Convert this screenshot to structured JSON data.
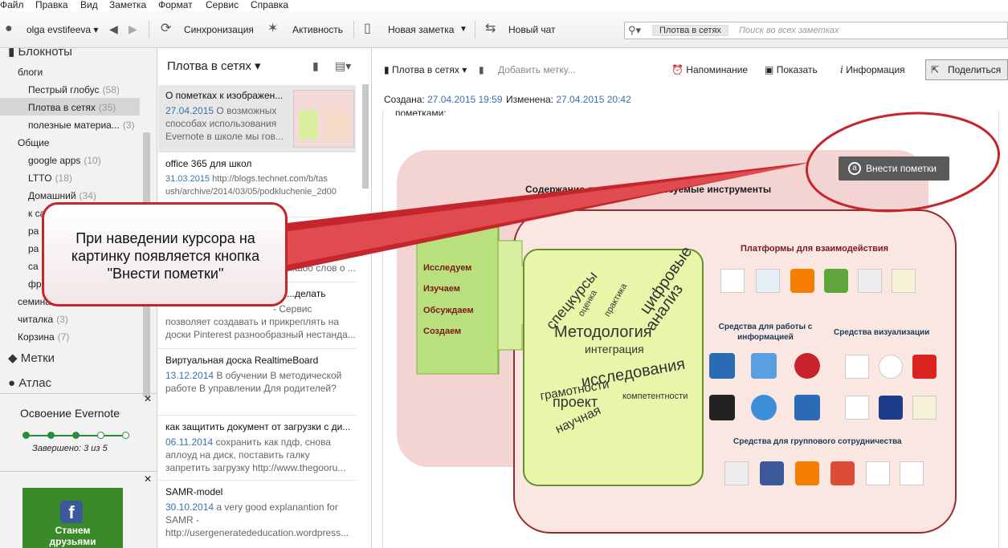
{
  "menu": [
    "Файл",
    "Правка",
    "Вид",
    "Заметка",
    "Формат",
    "Сервис",
    "Справка"
  ],
  "toolbar": {
    "user": "olga evstifeeva",
    "sync": "Синхронизация",
    "activity": "Активность",
    "new_note": "Новая заметка",
    "new_chat": "Новый чат",
    "search_scope": "Плотва в сетях",
    "search_placeholder": "Поиск во всех заметках"
  },
  "sidebar": {
    "notebooks_header": "Блокноты",
    "stacks": [
      {
        "label": "блоги",
        "items": [
          {
            "label": "Пестрый глобус",
            "count": "(58)"
          },
          {
            "label": "Плотва в сетях",
            "count": "(35)"
          },
          {
            "label": "полезные материа...",
            "count": "(3)"
          }
        ]
      },
      {
        "label": "Общие",
        "items": [
          {
            "label": "google apps",
            "count": "(10)"
          },
          {
            "label": "LTTO",
            "count": "(18)"
          },
          {
            "label": "Домашний",
            "count": "(34)"
          },
          {
            "label": "к са",
            "count": ""
          },
          {
            "label": "ра",
            "count": ""
          },
          {
            "label": "ра",
            "count": ""
          },
          {
            "label": "са",
            "count": ""
          },
          {
            "label": "фр",
            "count": ""
          }
        ]
      }
    ],
    "semina": "семина",
    "reader": {
      "label": "читалка",
      "count": "(3)"
    },
    "trash": {
      "label": "Корзина",
      "count": "(7)"
    },
    "tags": "Метки",
    "atlas": "Атлас",
    "learn_title": "Освоение Evernote",
    "learn_progress_text": "Завершено: 3 из 5",
    "learn_progress": {
      "done": 3,
      "total": 5
    },
    "fb_line1": "Станем",
    "fb_line2": "друзьями"
  },
  "note_list": {
    "title": "Плотва в сетях",
    "notes": [
      {
        "title": "О пометках к изображен...",
        "date": "27.04.2015",
        "snippet": [
          "О возможных",
          "способах использования",
          "Evernote в школе мы гов..."
        ]
      },
      {
        "title": "office 365 для школ",
        "date": "31.03.2015",
        "snippet": [
          "http://blogs.technet.com/b/tas",
          "ush/archive/2014/03/05/podkluchenie_2d00"
        ]
      },
      {
        "title": "",
        "date": "",
        "snippet": [
          "",
          "",
          "...шоо слов о ..."
        ]
      },
      {
        "title": "...делать",
        "date": "",
        "snippet": [
          "- Сервис",
          "позволяет создавать и прикреплять на",
          "доски Pinterest разнообразный нестанда..."
        ]
      },
      {
        "title": "Виртуальная доска RealtimeBoard",
        "date": "13.12.2014",
        "snippet": [
          "В обучении В методической",
          "работе В управлении Для родителей?"
        ]
      },
      {
        "title": "как защитить документ от загрузки с ди...",
        "date": "06.11.2014",
        "snippet": [
          "сохранить как пдф, снова",
          "аплоуд на диск, поставить галку",
          "запретить загрузку http://www.thegooru..."
        ]
      },
      {
        "title": "SAMR-model",
        "date": "30.10.2014",
        "snippet": [
          "a very good explanantion for",
          "SAMR -",
          "http://usergeneratededucation.wordpress..."
        ]
      }
    ]
  },
  "note": {
    "notebook": "Плотва в сетях",
    "add_tag": "Добавить метку...",
    "reminder": "Напоминание",
    "present": "Показать",
    "info": "Информация",
    "share": "Поделиться",
    "created_label": "Создана:",
    "created": "27.04.2015 19:59",
    "modified_label": "Изменена:",
    "modified": "27.04.2015 20:42",
    "body_top_text": "пометками:",
    "annotate_button": "Внести пометки",
    "callout": "При наведении курсора на картинку появляется кнопка \"Внести пометки\"",
    "diagram": {
      "title": "Содержание деяте... и используемые инструменты",
      "verbs": [
        "Исследуем",
        "Изучаем",
        "Обсуждаем",
        "Создаем"
      ],
      "cloud_words": [
        "цифровые",
        "анализ",
        "спецкурсы",
        "Методология",
        "интеграция",
        "исследования",
        "грамотности",
        "проект",
        "компетентности",
        "научная",
        "оценка",
        "практика"
      ],
      "platforms": "Платформы для взаимодействия",
      "info_tools": "Средства для работы с информацией",
      "vis_tools": "Средства визуализации",
      "group_tools": "Средства для группового сотрудничества"
    }
  },
  "colors": {
    "accent_green": "#2a8c3a",
    "callout_red": "#c4262c",
    "link_blue": "#3a6fb4"
  }
}
